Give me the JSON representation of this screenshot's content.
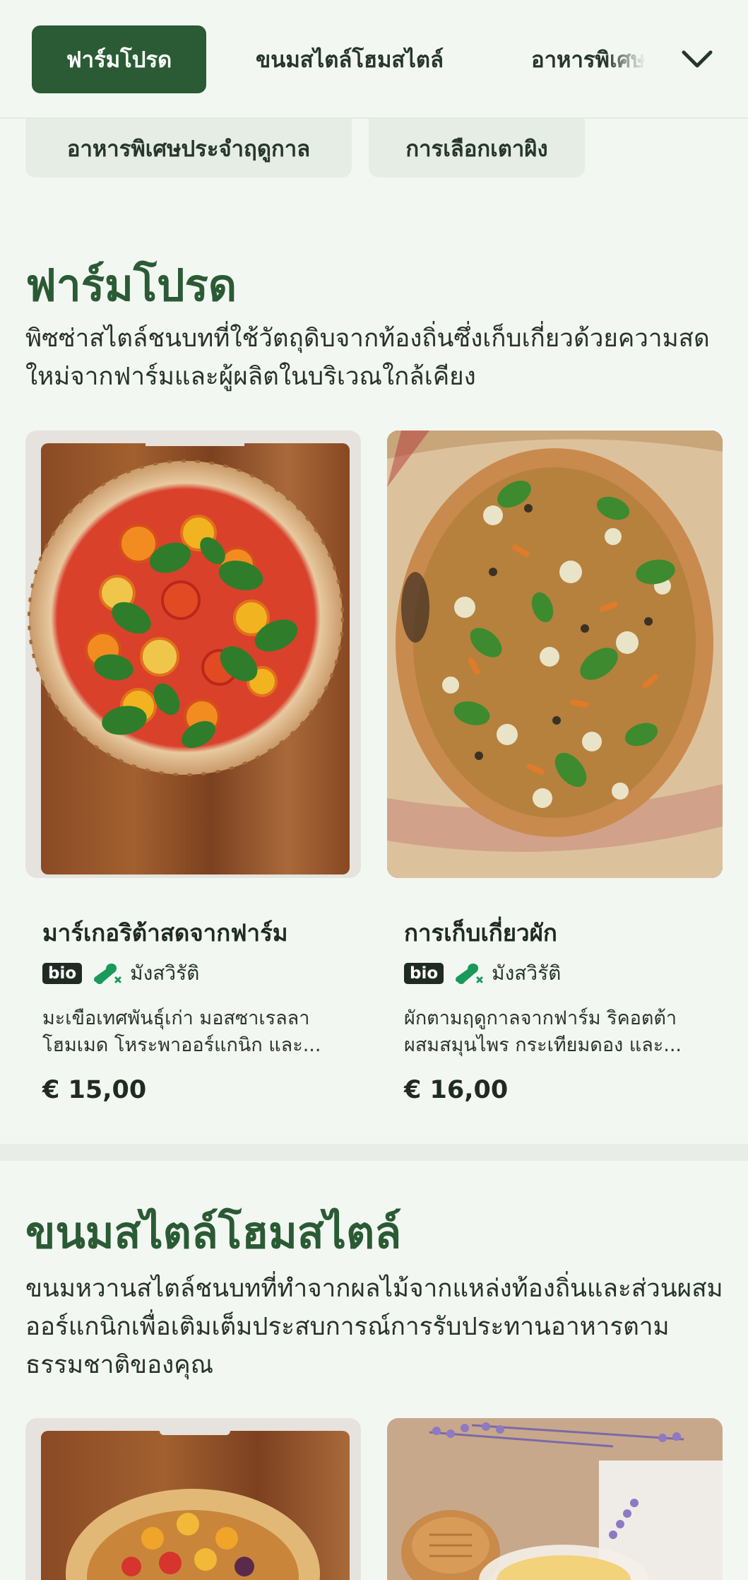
{
  "tabs": [
    {
      "label": "ฟาร์มโปรด"
    },
    {
      "label": "ขนมสไตล์โฮมสไตล์"
    },
    {
      "label": "อาหารพิเศษ"
    }
  ],
  "chips": [
    {
      "label": "อาหารพิเศษประจำฤดูกาล"
    },
    {
      "label": "การเลือกเตาผิง"
    }
  ],
  "sections": [
    {
      "title": "ฟาร์มโปรด",
      "description": "พิซซ่าสไตล์ชนบทที่ใช้วัตถุดิบจากท้องถิ่นซึ่งเก็บเกี่ยวด้วยความสดใหม่จากฟาร์มและผู้ผลิตในบริเวณใกล้เคียง",
      "items": [
        {
          "title": "มาร์เกอริต้าสดจากฟาร์ม",
          "badge": "bio",
          "diet": "มังสวิรัติ",
          "desc_line1": "มะเขือเทศพันธุ์เก่า มอสซาเรลลา",
          "desc_line2": "โฮมเมด โหระพาออร์แกนิก และ...",
          "price": "€ 15,00"
        },
        {
          "title": "การเก็บเกี่ยวผัก",
          "badge": "bio",
          "diet": "มังสวิรัติ",
          "desc_line1": "ผักตามฤดูกาลจากฟาร์ม ริคอตต้า",
          "desc_line2": "ผสมสมุนไพร กระเทียมดอง และ...",
          "price": "€ 16,00"
        }
      ]
    },
    {
      "title": "ขนมสไตล์โฮมสไตล์",
      "description": "ขนมหวานสไตล์ชนบทที่ทำจากผลไม้จากแหล่งท้องถิ่นและส่วนผสมออร์แกนิกเพื่อเติมเต็มประสบการณ์การรับประทานอาหารตามธรรมชาติของคุณ"
    }
  ],
  "colors": {
    "accent": "#2a5b34",
    "background": "#f3f7f2",
    "veg_icon": "#1a9a5a"
  },
  "icons": {
    "dropdown": "chevron-down-icon",
    "diet": "vegetarian-leg-icon"
  }
}
